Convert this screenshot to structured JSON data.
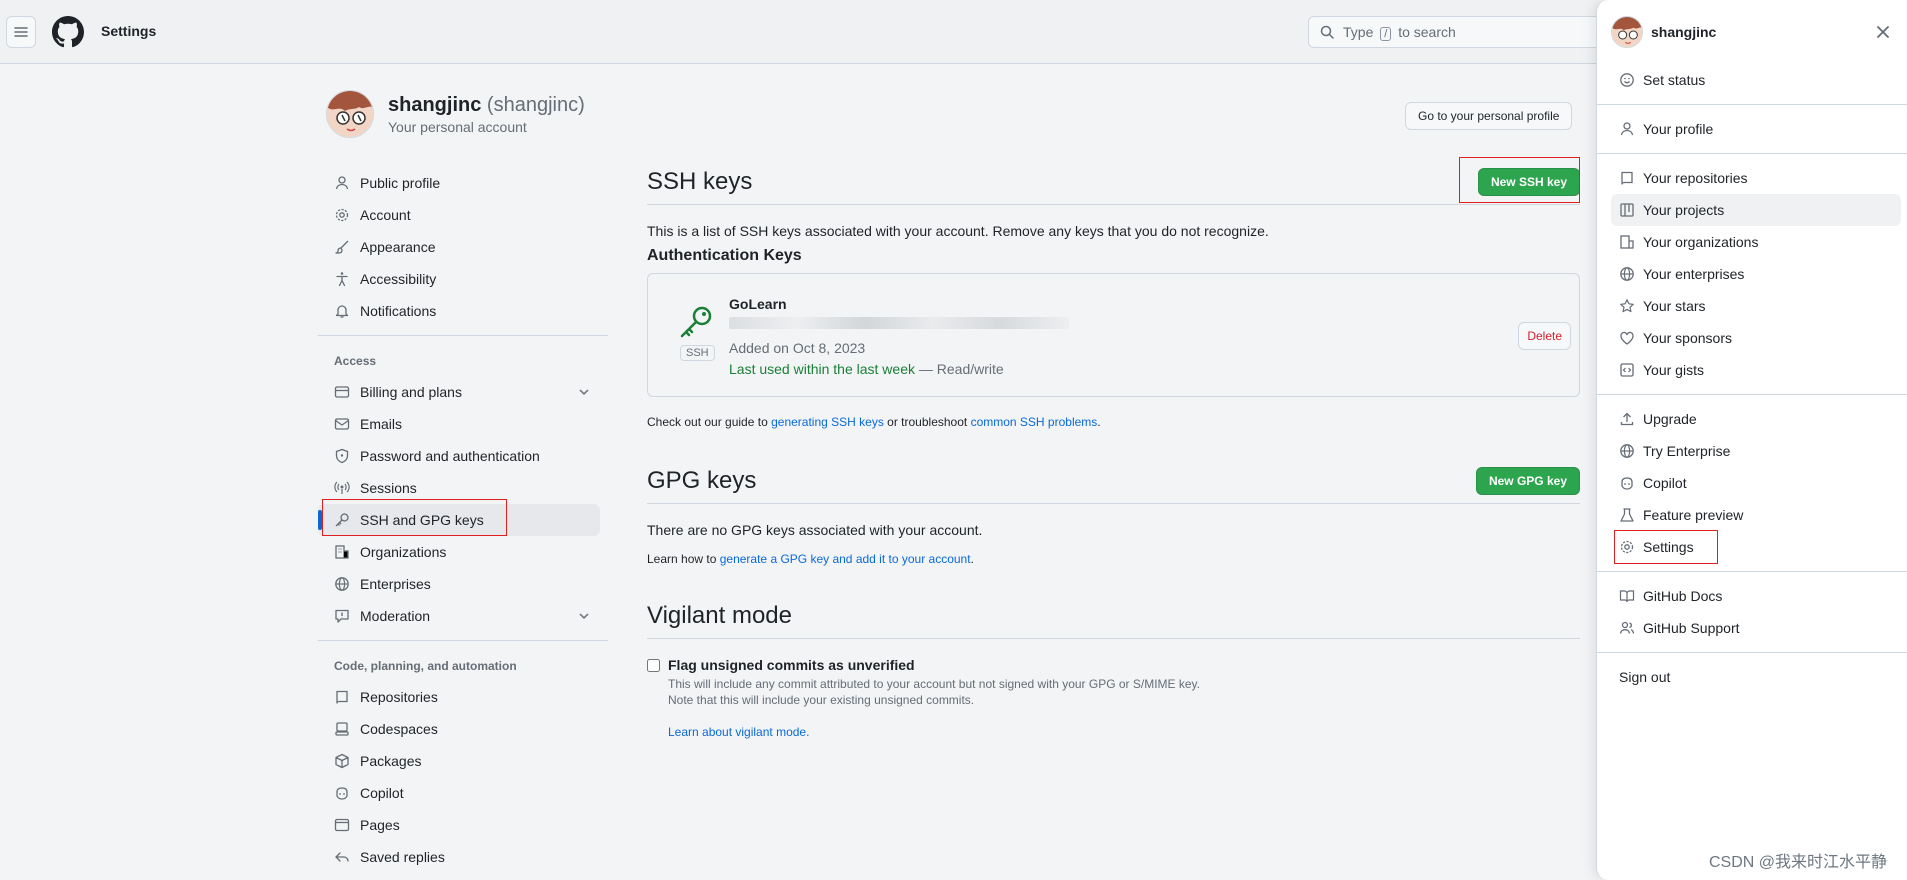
{
  "header": {
    "context": "Settings",
    "search_placeholder_pre": "Type",
    "search_key": "/",
    "search_placeholder_post": "to search"
  },
  "account": {
    "name": "shangjinc",
    "handle": "(shangjinc)",
    "subtitle": "Your personal account",
    "profile_button": "Go to your personal profile"
  },
  "sidebar": {
    "items_top": [
      {
        "label": "Public profile",
        "icon": "person-icon"
      },
      {
        "label": "Account",
        "icon": "gear-icon"
      },
      {
        "label": "Appearance",
        "icon": "paintbrush-icon"
      },
      {
        "label": "Accessibility",
        "icon": "accessibility-icon"
      },
      {
        "label": "Notifications",
        "icon": "bell-icon"
      }
    ],
    "access_heading": "Access",
    "items_access": [
      {
        "label": "Billing and plans",
        "icon": "credit-card-icon"
      },
      {
        "label": "Emails",
        "icon": "mail-icon"
      },
      {
        "label": "Password and authentication",
        "icon": "shield-lock-icon"
      },
      {
        "label": "Sessions",
        "icon": "broadcast-icon"
      },
      {
        "label": "SSH and GPG keys",
        "icon": "key-icon"
      },
      {
        "label": "Organizations",
        "icon": "organization-icon"
      },
      {
        "label": "Enterprises",
        "icon": "globe-icon"
      },
      {
        "label": "Moderation",
        "icon": "report-icon"
      }
    ],
    "code_heading": "Code, planning, and automation",
    "items_code": [
      {
        "label": "Repositories",
        "icon": "repo-icon"
      },
      {
        "label": "Codespaces",
        "icon": "codespaces-icon"
      },
      {
        "label": "Packages",
        "icon": "package-icon"
      },
      {
        "label": "Copilot",
        "icon": "copilot-icon"
      },
      {
        "label": "Pages",
        "icon": "browser-icon"
      },
      {
        "label": "Saved replies",
        "icon": "reply-icon"
      }
    ]
  },
  "ssh": {
    "title": "SSH keys",
    "new_button": "New SSH key",
    "intro": "This is a list of SSH keys associated with your account. Remove any keys that you do not recognize.",
    "auth_heading": "Authentication Keys",
    "key": {
      "title": "GoLearn",
      "badge": "SSH",
      "added": "Added on Oct 8, 2023",
      "last_used": "Last used within the last week",
      "access": "— Read/write",
      "delete_button": "Delete"
    },
    "guide_pre": "Check out our guide to",
    "guide_link1": "generating SSH keys",
    "guide_mid": "or troubleshoot",
    "guide_link2": "common SSH problems",
    "guide_end": "."
  },
  "gpg": {
    "title": "GPG keys",
    "new_button": "New GPG key",
    "empty": "There are no GPG keys associated with your account.",
    "learn_pre": "Learn how to",
    "learn_link": "generate a GPG key and add it to your account",
    "learn_end": "."
  },
  "vigilant": {
    "title": "Vigilant mode",
    "checkbox_label": "Flag unsigned commits as unverified",
    "checked": false,
    "desc1": "This will include any commit attributed to your account but not signed with your GPG or S/MIME key.",
    "desc2": "Note that this will include your existing unsigned commits.",
    "learn_link": "Learn about vigilant mode."
  },
  "drawer": {
    "username": "shangjinc",
    "items1": [
      {
        "label": "Set status",
        "icon": "smiley-icon"
      }
    ],
    "items2": [
      {
        "label": "Your profile",
        "icon": "person-icon"
      }
    ],
    "items3": [
      {
        "label": "Your repositories",
        "icon": "repo-icon"
      },
      {
        "label": "Your projects",
        "icon": "table-icon"
      },
      {
        "label": "Your organizations",
        "icon": "organization-icon"
      },
      {
        "label": "Your enterprises",
        "icon": "globe-icon"
      },
      {
        "label": "Your stars",
        "icon": "star-icon"
      },
      {
        "label": "Your sponsors",
        "icon": "heart-icon"
      },
      {
        "label": "Your gists",
        "icon": "code-square-icon"
      }
    ],
    "items4": [
      {
        "label": "Upgrade",
        "icon": "upload-icon"
      },
      {
        "label": "Try Enterprise",
        "icon": "globe-icon"
      },
      {
        "label": "Copilot",
        "icon": "copilot-icon"
      },
      {
        "label": "Feature preview",
        "icon": "beaker-icon"
      },
      {
        "label": "Settings",
        "icon": "gear-icon"
      }
    ],
    "items5": [
      {
        "label": "GitHub Docs",
        "icon": "book-icon"
      },
      {
        "label": "GitHub Support",
        "icon": "people-icon"
      }
    ],
    "sign_out": "Sign out"
  },
  "watermark": "CSDN @我来时江水平静"
}
